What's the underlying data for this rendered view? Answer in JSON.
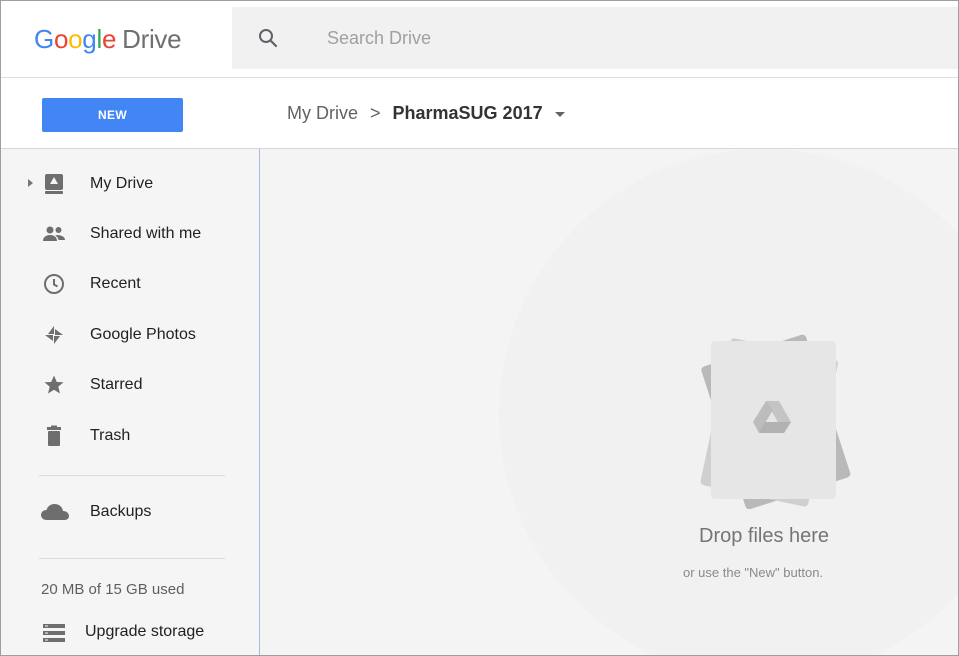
{
  "header": {
    "logo_word": "Google",
    "logo_letters": [
      "G",
      "o",
      "o",
      "g",
      "l",
      "e"
    ],
    "product": "Drive",
    "search_placeholder": "Search Drive"
  },
  "actions": {
    "new_label": "NEW"
  },
  "breadcrumb": {
    "root": "My Drive",
    "separator": ">",
    "current": "PharmaSUG 2017"
  },
  "sidebar": {
    "items": [
      {
        "label": "My Drive",
        "icon": "drive-icon"
      },
      {
        "label": "Shared with me",
        "icon": "people-icon"
      },
      {
        "label": "Recent",
        "icon": "clock-icon"
      },
      {
        "label": "Google Photos",
        "icon": "pinwheel-icon"
      },
      {
        "label": "Starred",
        "icon": "star-icon"
      },
      {
        "label": "Trash",
        "icon": "trash-icon"
      },
      {
        "label": "Backups",
        "icon": "cloud-icon"
      }
    ],
    "storage_text": "20 MB of 15 GB used",
    "upgrade_label": "Upgrade storage"
  },
  "empty_state": {
    "title": "Drop files here",
    "subtitle": "or use the \"New\" button."
  },
  "colors": {
    "accent": "#4285f4",
    "sidebar_bg": "#f5f5f5",
    "main_bg": "#f4f4f4"
  }
}
